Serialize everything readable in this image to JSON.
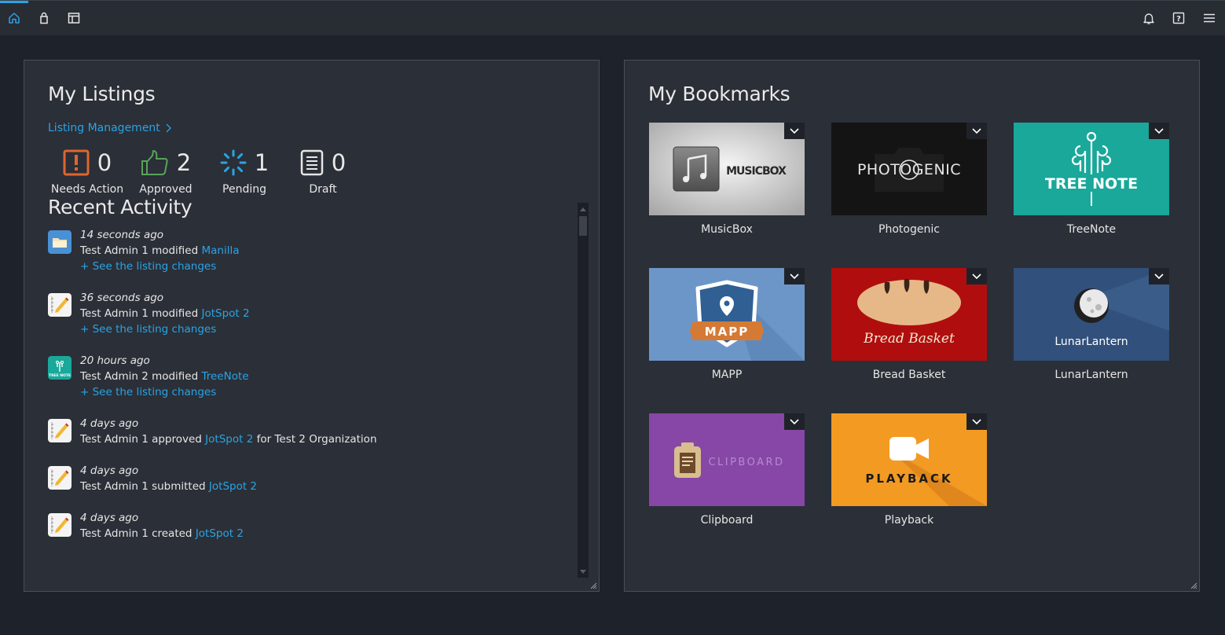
{
  "topbar": {
    "left_icons": [
      "home-icon",
      "bag-icon",
      "layout-icon"
    ],
    "right_icons": [
      "bell-icon",
      "help-icon",
      "menu-icon"
    ],
    "accent": "#2aa3e6"
  },
  "listings": {
    "title": "My Listings",
    "management_link": "Listing Management",
    "stats": [
      {
        "label": "Needs Action",
        "count": "0",
        "icon": "alert-icon",
        "color": "#e0652e"
      },
      {
        "label": "Approved",
        "count": "2",
        "icon": "thumbs-up-icon",
        "color": "#5aa35a"
      },
      {
        "label": "Pending",
        "count": "1",
        "icon": "spinner-icon",
        "color": "#2aa3e6"
      },
      {
        "label": "Draft",
        "count": "0",
        "icon": "document-icon",
        "color": "#e6e6e6"
      }
    ]
  },
  "activity": {
    "title": "Recent Activity",
    "see_changes": "+ See the listing changes",
    "items": [
      {
        "time": "14 seconds ago",
        "actor": "Test Admin 1",
        "verb": "modified",
        "target": "Manilla",
        "suffix": "",
        "icon": "manilla-icon",
        "has_changes": true
      },
      {
        "time": "36 seconds ago",
        "actor": "Test Admin 1",
        "verb": "modified",
        "target": "JotSpot 2",
        "suffix": "",
        "icon": "jotspot-icon",
        "has_changes": true
      },
      {
        "time": "20 hours ago",
        "actor": "Test Admin 2",
        "verb": "modified",
        "target": "TreeNote",
        "suffix": "",
        "icon": "treenote-icon",
        "has_changes": true
      },
      {
        "time": "4 days ago",
        "actor": "Test Admin 1",
        "verb": "approved",
        "target": "JotSpot 2",
        "suffix": "for Test 2 Organization",
        "icon": "jotspot-icon",
        "has_changes": false
      },
      {
        "time": "4 days ago",
        "actor": "Test Admin 1",
        "verb": "submitted",
        "target": "JotSpot 2",
        "suffix": "",
        "icon": "jotspot-icon",
        "has_changes": false
      },
      {
        "time": "4 days ago",
        "actor": "Test Admin 1",
        "verb": "created",
        "target": "JotSpot 2",
        "suffix": "",
        "icon": "jotspot-icon",
        "has_changes": false
      }
    ]
  },
  "bookmarks": {
    "title": "My Bookmarks",
    "items": [
      {
        "name": "MusicBox",
        "logo_text": "MUSICBOX"
      },
      {
        "name": "Photogenic",
        "logo_text": "PHOTOGENIC"
      },
      {
        "name": "TreeNote",
        "logo_text": "TREE NOTE"
      },
      {
        "name": "MAPP",
        "logo_text": "MAPP"
      },
      {
        "name": "Bread Basket",
        "logo_text": "Bread Basket"
      },
      {
        "name": "LunarLantern",
        "logo_text": "LunarLantern"
      },
      {
        "name": "Clipboard",
        "logo_text": "CLIPBOARD"
      },
      {
        "name": "Playback",
        "logo_text": "PLAYBACK"
      }
    ]
  }
}
